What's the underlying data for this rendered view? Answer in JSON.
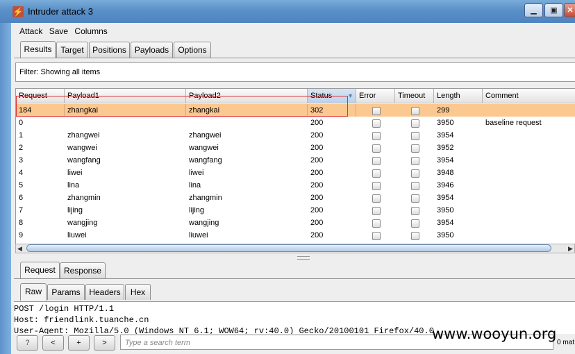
{
  "window": {
    "title": "Intruder attack 3"
  },
  "menu": [
    "Attack",
    "Save",
    "Columns"
  ],
  "main_tabs": [
    {
      "label": "Results",
      "active": true
    },
    {
      "label": "Target"
    },
    {
      "label": "Positions"
    },
    {
      "label": "Payloads"
    },
    {
      "label": "Options"
    }
  ],
  "filter": {
    "text": "Filter:  Showing all items"
  },
  "table": {
    "columns": [
      "Request",
      "Payload1",
      "Payload2",
      "Status",
      "Error",
      "Timeout",
      "Length",
      "Comment"
    ],
    "sorted_column": "Status",
    "rows": [
      {
        "request": "184",
        "payload1": "zhangkai",
        "payload2": "zhangkai",
        "status": "302",
        "length": "299",
        "comment": "",
        "selected": true
      },
      {
        "request": "0",
        "payload1": "",
        "payload2": "",
        "status": "200",
        "length": "3950",
        "comment": "baseline request"
      },
      {
        "request": "1",
        "payload1": "zhangwei",
        "payload2": "zhangwei",
        "status": "200",
        "length": "3954",
        "comment": ""
      },
      {
        "request": "2",
        "payload1": "wangwei",
        "payload2": "wangwei",
        "status": "200",
        "length": "3952",
        "comment": ""
      },
      {
        "request": "3",
        "payload1": "wangfang",
        "payload2": "wangfang",
        "status": "200",
        "length": "3954",
        "comment": ""
      },
      {
        "request": "4",
        "payload1": "liwei",
        "payload2": "liwei",
        "status": "200",
        "length": "3948",
        "comment": ""
      },
      {
        "request": "5",
        "payload1": "lina",
        "payload2": "lina",
        "status": "200",
        "length": "3946",
        "comment": ""
      },
      {
        "request": "6",
        "payload1": "zhangmin",
        "payload2": "zhangmin",
        "status": "200",
        "length": "3954",
        "comment": ""
      },
      {
        "request": "7",
        "payload1": "lijing",
        "payload2": "lijing",
        "status": "200",
        "length": "3950",
        "comment": ""
      },
      {
        "request": "8",
        "payload1": "wangjing",
        "payload2": "wangjing",
        "status": "200",
        "length": "3954",
        "comment": ""
      },
      {
        "request": "9",
        "payload1": "liuwei",
        "payload2": "liuwei",
        "status": "200",
        "length": "3950",
        "comment": ""
      }
    ]
  },
  "detail_tabs": [
    {
      "label": "Request",
      "active": true
    },
    {
      "label": "Response"
    }
  ],
  "view_tabs": [
    {
      "label": "Raw",
      "active": true
    },
    {
      "label": "Params"
    },
    {
      "label": "Headers"
    },
    {
      "label": "Hex"
    }
  ],
  "request_text": [
    "POST /login HTTP/1.1",
    "Host: friendlink.tuanche.cn",
    "User-Agent: Mozilla/5.0 (Windows NT 6.1; WOW64; rv:40.0) Gecko/20100101 Firefox/40.0"
  ],
  "bottom": {
    "help_label": "?",
    "prev_label": "<",
    "add_label": "+",
    "next_label": ">",
    "search_placeholder": "Type a search term",
    "matches": "0 mat"
  },
  "watermark": "www.wooyun.org",
  "colors": {
    "selected_row": "#fbc890",
    "highlight_box": "#e03030",
    "titlebar": "#5a90c8"
  }
}
